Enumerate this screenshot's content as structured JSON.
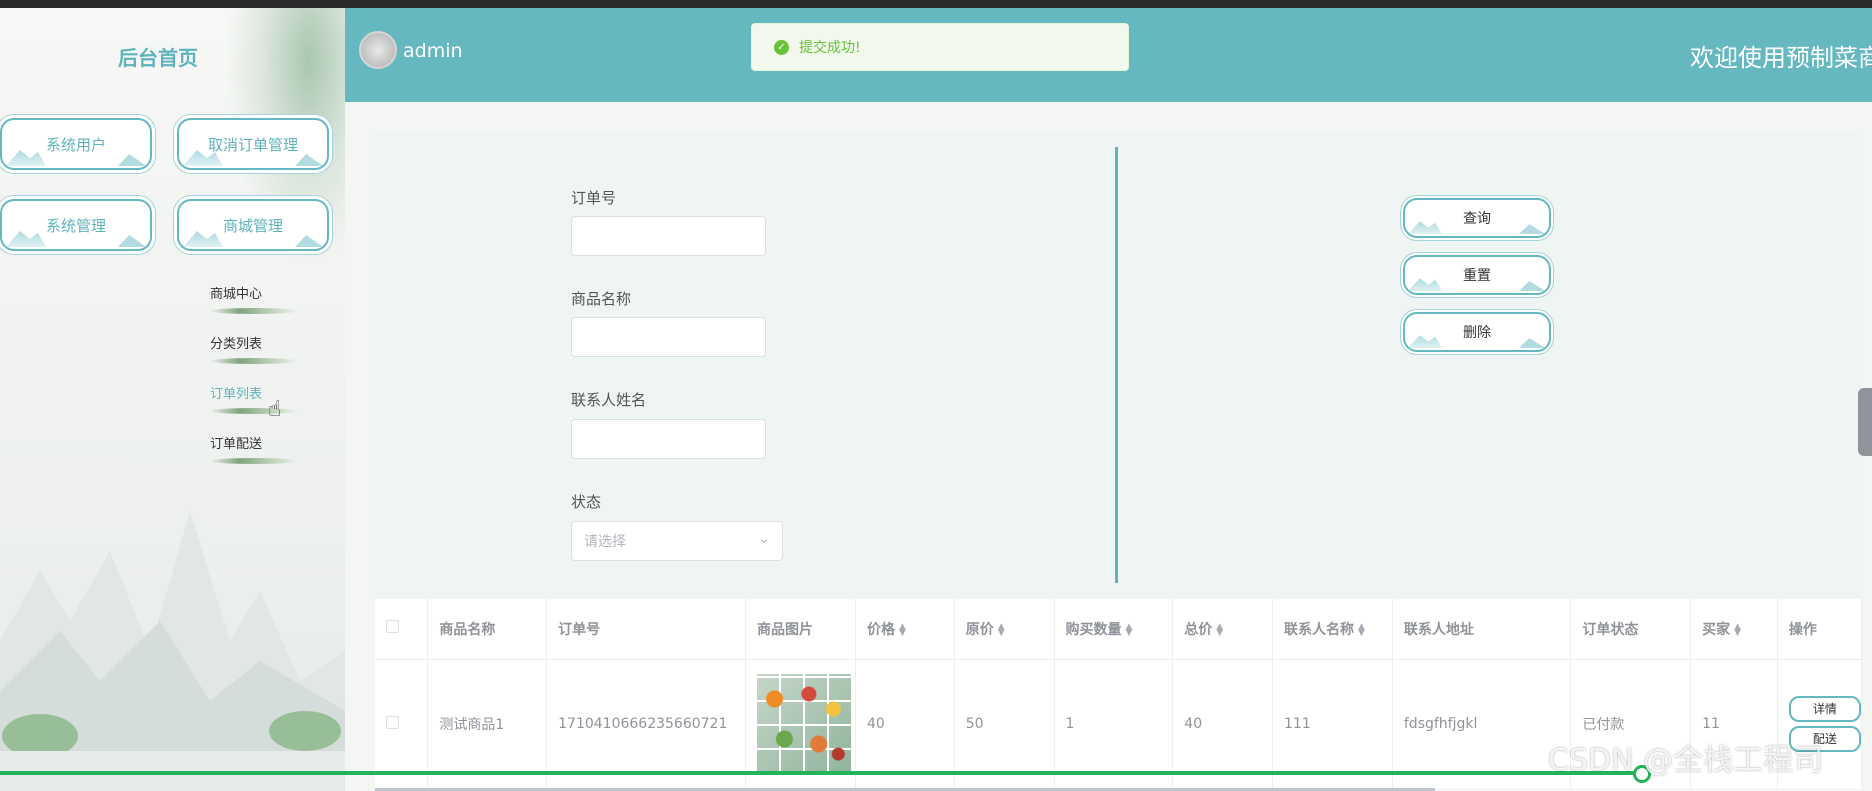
{
  "sidebar": {
    "title": "后台首页",
    "nav_buttons": [
      "系统用户",
      "取消订单管理",
      "系统管理",
      "商城管理"
    ],
    "sub_items": [
      "商城中心",
      "分类列表",
      "订单列表",
      "订单配送"
    ],
    "active_sub_item": "订单列表"
  },
  "header": {
    "username": "admin",
    "welcome": "欢迎使用预制菜商",
    "bg_color": "#66b8c0"
  },
  "toast": {
    "message": "提交成功!",
    "icon": "check-circle-icon"
  },
  "search": {
    "fields": [
      {
        "label": "订单号",
        "value": ""
      },
      {
        "label": "商品名称",
        "value": ""
      },
      {
        "label": "联系人姓名",
        "value": ""
      }
    ],
    "status_label": "状态",
    "status_placeholder": "请选择",
    "buttons": [
      "查询",
      "重置",
      "删除"
    ]
  },
  "table": {
    "headers": [
      "商品名称",
      "订单号",
      "商品图片",
      "价格",
      "原价",
      "购买数量",
      "总价",
      "联系人名称",
      "联系人地址",
      "订单状态",
      "买家",
      "操作"
    ],
    "rows": [
      {
        "product_name": "测试商品1",
        "order_no": "1710410666235660721",
        "price": "40",
        "original_price": "50",
        "quantity": "1",
        "total": "40",
        "contact_name": "111",
        "contact_address": "fdsgfhfjgkl",
        "status": "已付款",
        "buyer": "11",
        "ops": [
          "详情",
          "配送"
        ]
      }
    ]
  },
  "watermark": "CSDN @全栈工程司",
  "video_progress": 0.877,
  "accent_color": "#5fb3bd"
}
